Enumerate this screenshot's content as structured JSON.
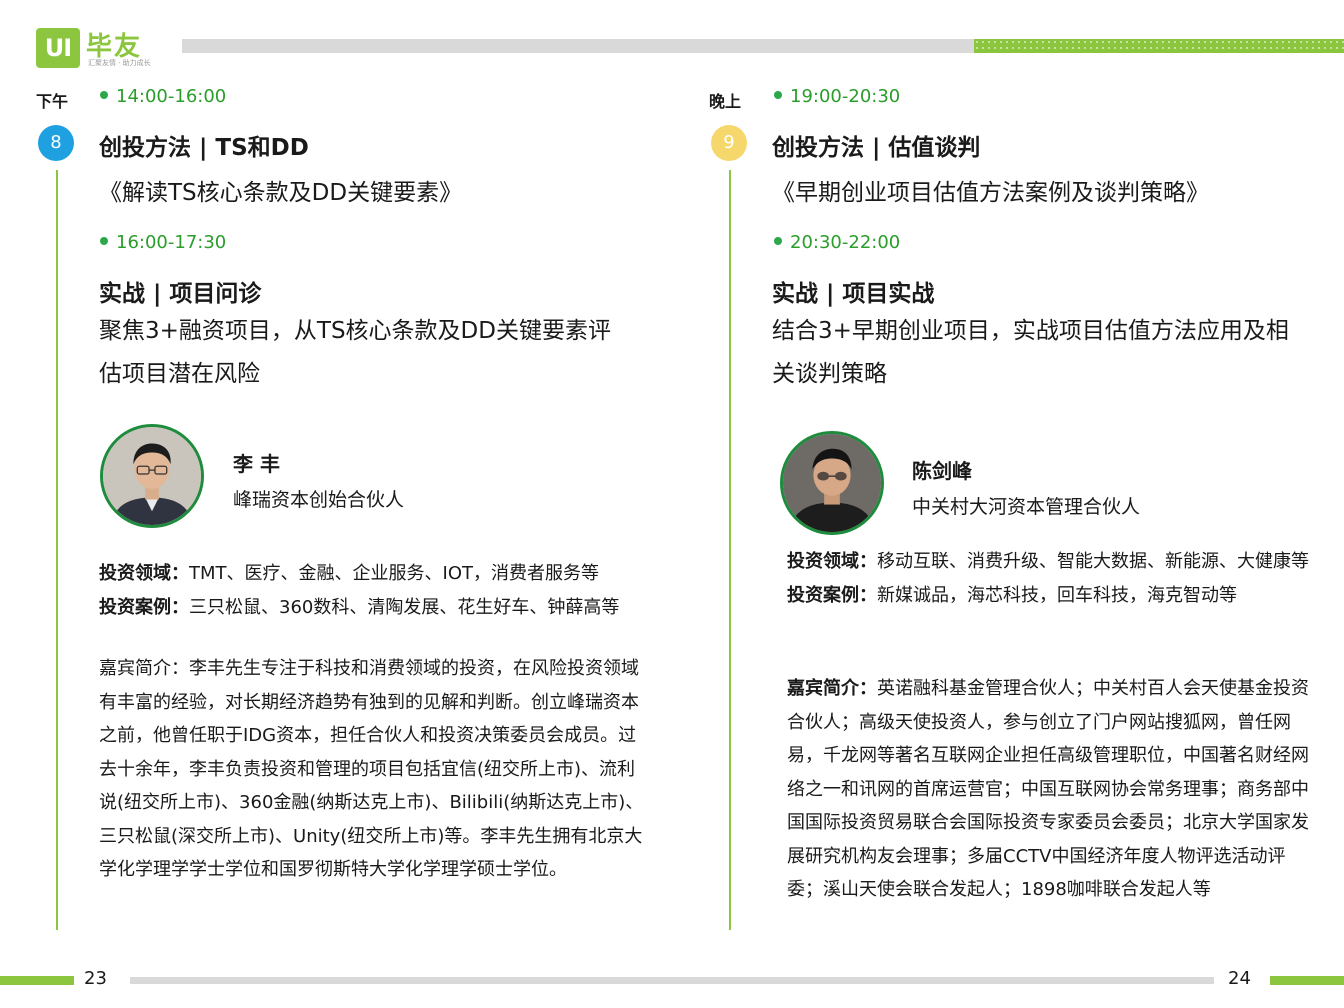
{
  "header": {
    "logo_mark": "UI",
    "logo_name": "毕友",
    "logo_slogan": "汇聚友情 · 助力成长"
  },
  "left": {
    "period": "下午",
    "number": "8",
    "session1": {
      "time": "14:00-16:00",
      "title": "创投方法 | TS和DD",
      "subtitle": "《解读TS核心条款及DD关键要素》"
    },
    "session2": {
      "time": "16:00-17:30",
      "title": "实战 | 项目问诊",
      "desc_line1": "聚焦3+融资项目，从TS核心条款及DD关键要素评",
      "desc_line2": "估项目潜在风险"
    },
    "speaker": {
      "name": "李  丰",
      "role": "峰瑞资本创始合伙人",
      "field_label": "投资领域：",
      "field_value": "TMT、医疗、金融、企业服务、IOT，消费者服务等",
      "cases_label": "投资案例：",
      "cases_value": "三只松鼠、360数科、清陶发展、花生好车、钟薛高等",
      "bio": "嘉宾简介：李丰先生专注于科技和消费领域的投资，在风险投资领域有丰富的经验，对长期经济趋势有独到的见解和判断。创立峰瑞资本之前，他曾任职于IDG资本，担任合伙人和投资决策委员会成员。过去十余年，李丰负责投资和管理的项目包括宜信(纽交所上市)、流利说(纽交所上市)、360金融(纳斯达克上市)、Bilibili(纳斯达克上市)、三只松鼠(深交所上市)、Unity(纽交所上市)等。李丰先生拥有北京大学化学理学学士学位和国罗彻斯特大学化学理学硕士学位。"
    }
  },
  "right": {
    "period": "晚上",
    "number": "9",
    "session1": {
      "time": "19:00-20:30",
      "title": "创投方法 | 估值谈判",
      "subtitle": "《早期创业项目估值方法案例及谈判策略》"
    },
    "session2": {
      "time": "20:30-22:00",
      "title": "实战 | 项目实战",
      "desc_line1": "结合3+早期创业项目，实战项目估值方法应用及相",
      "desc_line2": "关谈判策略"
    },
    "speaker": {
      "name": "陈剑峰",
      "role": "中关村大河资本管理合伙人",
      "field_label": "投资领域：",
      "field_value": "移动互联、消费升级、智能大数据、新能源、大健康等",
      "cases_label": "投资案例：",
      "cases_value": "新媒诚品，海芯科技，回车科技，海克智动等",
      "bio_label": "嘉宾简介：",
      "bio_value": "英诺融科基金管理合伙人；中关村百人会天使基金投资合伙人；高级天使投资人，参与创立了门户网站搜狐网，曾任网易，千龙网等著名互联网企业担任高级管理职位，中国著名财经网络之一和讯网的首席运营官；中国互联网协会常务理事；商务部中国国际投资贸易联合会国际投资专家委员会委员；北京大学国家发展研究机构友会理事；多届CCTV中国经济年度人物评选活动评委；溪山天使会联合发起人；1898咖啡联合发起人等"
    }
  },
  "footer": {
    "page_left": "23",
    "page_right": "24"
  },
  "colors": {
    "brand_green": "#8cc63f",
    "time_green": "#2a9d2a",
    "badge_blue": "#1fa0e0",
    "badge_yellow": "#f6d76b"
  }
}
